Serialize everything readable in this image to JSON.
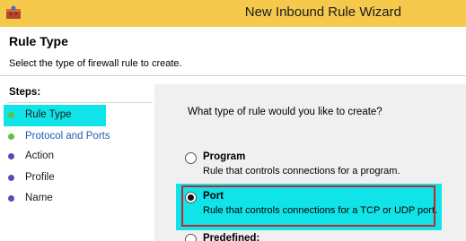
{
  "window": {
    "title": "New Inbound Rule Wizard",
    "icon": "firewall-wizard-icon"
  },
  "header": {
    "title": "Rule Type",
    "subtitle": "Select the type of firewall rule to create."
  },
  "steps": {
    "title": "Steps:",
    "items": [
      {
        "label": "Rule Type",
        "color": "#1a1a1a",
        "bullet": "#5cc23d",
        "active": true
      },
      {
        "label": "Protocol and Ports",
        "color": "#1f5fb2",
        "bullet": "#5cc23d",
        "active": false
      },
      {
        "label": "Action",
        "color": "#1a1a1a",
        "bullet": "#5b4ab8",
        "active": false
      },
      {
        "label": "Profile",
        "color": "#1a1a1a",
        "bullet": "#5b4ab8",
        "active": false
      },
      {
        "label": "Name",
        "color": "#1a1a1a",
        "bullet": "#5b4ab8",
        "active": false
      }
    ]
  },
  "content": {
    "question": "What type of rule would you like to create?",
    "options": [
      {
        "label": "Program",
        "description": "Rule that controls connections for a program.",
        "selected": false
      },
      {
        "label": "Port",
        "description": "Rule that controls connections for a TCP or UDP port.",
        "selected": true
      },
      {
        "label": "Predefined:",
        "description": "",
        "selected": false
      }
    ]
  },
  "colors": {
    "titlebar": "#f5ca4c",
    "highlight": "#11e4e8",
    "annotation_border": "#c1272d"
  }
}
